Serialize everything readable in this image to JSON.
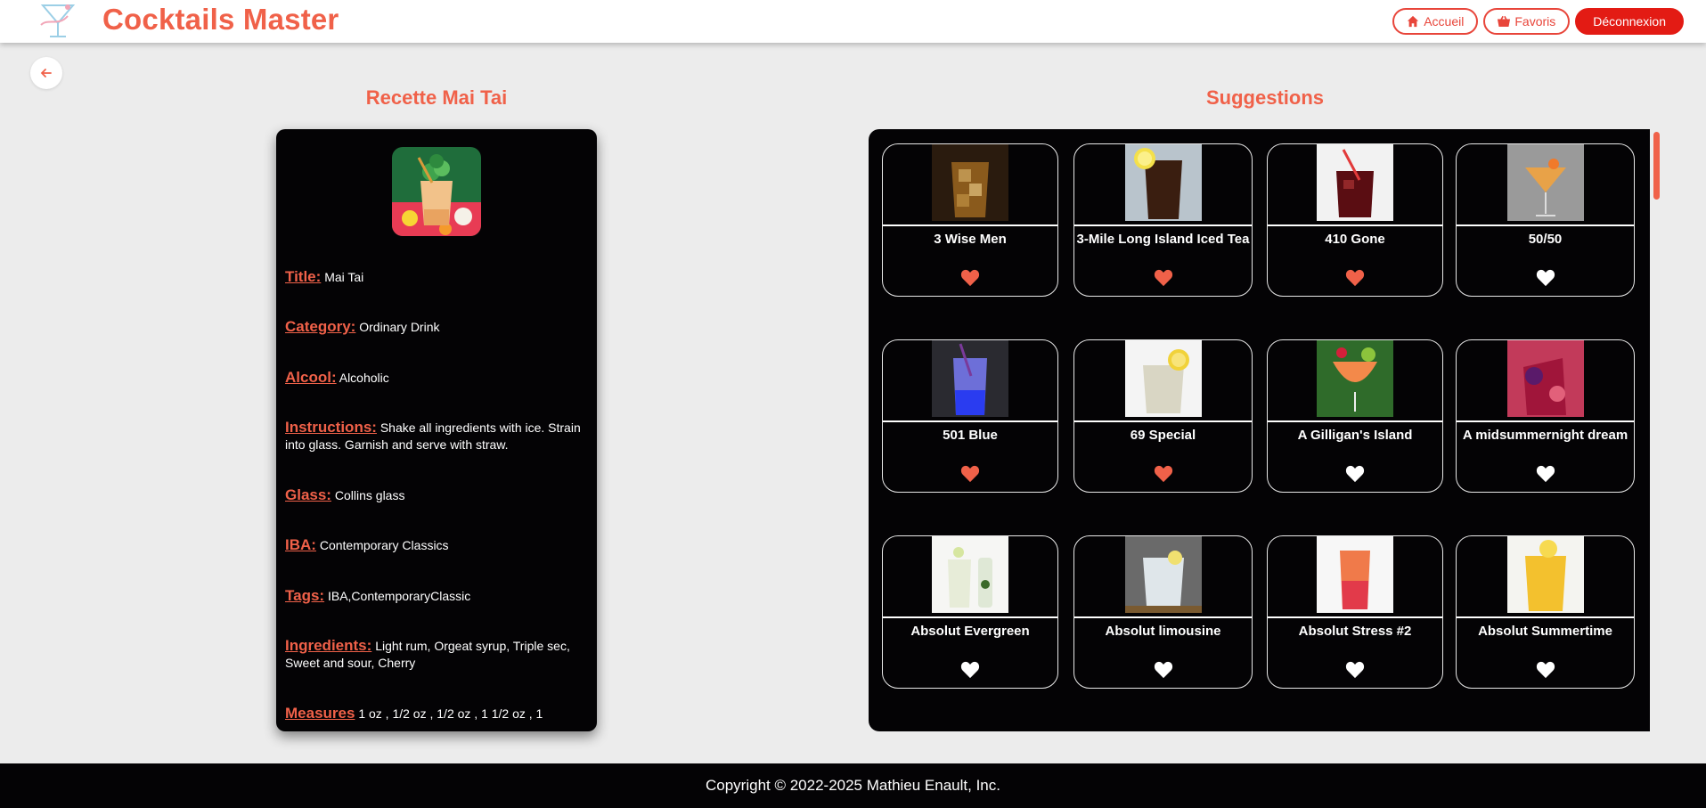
{
  "header": {
    "brand": "Cocktails Master",
    "nav": {
      "home": "Accueil",
      "favorites": "Favoris",
      "logout": "Déconnexion"
    }
  },
  "recipe": {
    "heading": "Recette Mai Tai",
    "fields": [
      {
        "label": "Title:",
        "value": "Mai Tai"
      },
      {
        "label": "Category:",
        "value": "Ordinary Drink"
      },
      {
        "label": "Alcool:",
        "value": "Alcoholic"
      },
      {
        "label": "Instructions:",
        "value": "Shake all ingredients with ice. Strain into glass. Garnish and serve with straw."
      },
      {
        "label": "Glass:",
        "value": "Collins glass"
      },
      {
        "label": "IBA:",
        "value": "Contemporary Classics"
      },
      {
        "label": "Tags:",
        "value": "IBA,ContemporaryClassic"
      },
      {
        "label": "Ingredients:",
        "value": "Light rum, Orgeat syrup, Triple sec, Sweet and sour, Cherry"
      },
      {
        "label": "Measures",
        "value": "1 oz , 1/2 oz , 1/2 oz , 1 1/2 oz , 1"
      }
    ]
  },
  "suggestions": {
    "heading": "Suggestions",
    "items": [
      {
        "name": "3 Wise Men",
        "favorite": true
      },
      {
        "name": "3-Mile Long Island Iced Tea",
        "favorite": true
      },
      {
        "name": "410 Gone",
        "favorite": true
      },
      {
        "name": "50/50",
        "favorite": false
      },
      {
        "name": "501 Blue",
        "favorite": true
      },
      {
        "name": "69 Special",
        "favorite": true
      },
      {
        "name": "A Gilligan's Island",
        "favorite": false
      },
      {
        "name": "A midsummernight dream",
        "favorite": false
      },
      {
        "name": "Absolut Evergreen",
        "favorite": false
      },
      {
        "name": "Absolut limousine",
        "favorite": false
      },
      {
        "name": "Absolut Stress #2",
        "favorite": false
      },
      {
        "name": "Absolut Summertime",
        "favorite": false
      }
    ]
  },
  "footer": {
    "copyright": "Copyright © 2022-2025 Mathieu Enault, Inc."
  },
  "colors": {
    "accent": "#f06149",
    "danger": "#e31b14",
    "panel": "#040305",
    "background": "#ececec",
    "heart_fav": "#f06149",
    "heart_plain": "#ffffff"
  }
}
